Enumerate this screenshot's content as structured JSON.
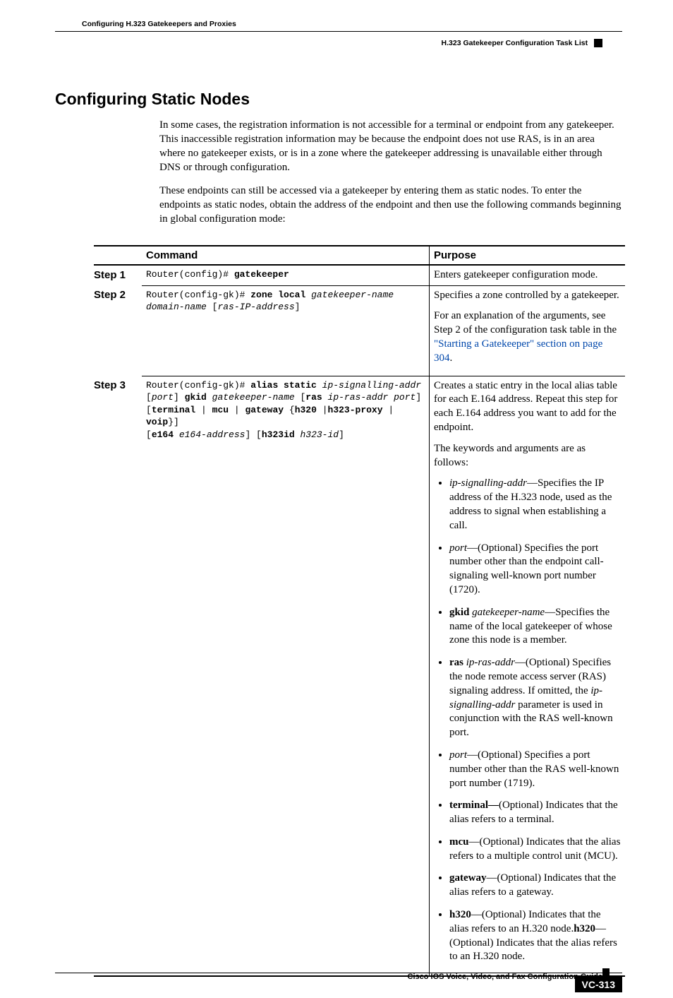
{
  "header": {
    "left": "Configuring H.323 Gatekeepers and Proxies",
    "right": "H.323 Gatekeeper Configuration Task List"
  },
  "section_title": "Configuring Static Nodes",
  "para1": "In some cases, the registration information is not accessible for a terminal or endpoint from any gatekeeper. This inaccessible registration information may be because the endpoint does not use RAS, is in an area where no gatekeeper exists, or is in a zone where the gatekeeper addressing is unavailable either through DNS or through configuration.",
  "para2": "These endpoints can still be accessed via a gatekeeper by entering them as static nodes. To enter the endpoints as static nodes, obtain the address of the endpoint and then use the following commands beginning in global configuration mode:",
  "table": {
    "head_command": "Command",
    "head_purpose": "Purpose",
    "step1_label": "Step 1",
    "step2_label": "Step 2",
    "step3_label": "Step 3",
    "r1": {
      "cmd_prefix": "Router(config)# ",
      "cmd_bold": "gatekeeper",
      "purpose": "Enters gatekeeper configuration mode."
    },
    "r2": {
      "cmd_l1a": "Router(config-gk)# ",
      "cmd_l1b": "zone local ",
      "cmd_l1c": "gatekeeper-name",
      "cmd_l2a": "domain-name ",
      "cmd_l2b": "[",
      "cmd_l2c": "ras-IP-address",
      "cmd_l2d": "]",
      "p1": "Specifies a zone controlled by a gatekeeper.",
      "p2a": "For an explanation of the arguments, see Step 2 of the configuration task table in the ",
      "p2b": "\"Starting a Gatekeeper\" section on page 304",
      "p2c": "."
    },
    "r3": {
      "cmd_l1a": "Router(config-gk)# ",
      "cmd_l1b": "alias static ",
      "cmd_l1c": "ip-signalling-addr",
      "cmd_l2a": "[",
      "cmd_l2b": "port",
      "cmd_l2c": "] ",
      "cmd_l2d": "gkid ",
      "cmd_l2e": "gatekeeper-name ",
      "cmd_l2f": "[",
      "cmd_l2g": "ras ",
      "cmd_l2h": "ip-ras-addr port",
      "cmd_l2i": "]",
      "cmd_l3a": "[",
      "cmd_l3b": "terminal",
      "cmd_l3c": " | ",
      "cmd_l3d": "mcu",
      "cmd_l3e": " | ",
      "cmd_l3f": "gateway ",
      "cmd_l3g": "{",
      "cmd_l3h": "h320 ",
      "cmd_l3i": "|",
      "cmd_l3j": "h323-proxy",
      "cmd_l3k": " | ",
      "cmd_l3l": "voip",
      "cmd_l3m": "}]",
      "cmd_l4a": "[",
      "cmd_l4b": "e164 ",
      "cmd_l4c": "e164-address",
      "cmd_l4d": "] [",
      "cmd_l4e": "h323id ",
      "cmd_l4f": "h323-id",
      "cmd_l4g": "]",
      "p1": "Creates a static entry in the local alias table for each E.164 address. Repeat this step for each E.164 address you want to add for the endpoint.",
      "p2": "The keywords and arguments are as follows:",
      "li1a": "ip-signalling-addr",
      "li1b": "—Specifies the IP address of the H.323 node, used as the address to signal when establishing a call.",
      "li2a": "port",
      "li2b": "—(Optional) Specifies the port number other than the endpoint call-signaling well-known port number (1720).",
      "li3a": "gkid ",
      "li3b": "gatekeeper-name",
      "li3c": "—Specifies the name of the local gatekeeper of whose zone this node is a member.",
      "li4a": "ras ",
      "li4b": "ip-ras-addr",
      "li4c": "—(Optional) Specifies the node remote access server (RAS) signaling address. If omitted, the ",
      "li4d": "ip-signalling-addr",
      "li4e": " parameter is used in conjunction with the RAS well-known port.",
      "li5a": "port",
      "li5b": "—(Optional) Specifies a port number other than the RAS well-known port number (1719).",
      "li6a": "terminal—",
      "li6b": "(Optional) Indicates that the alias refers to a terminal.",
      "li7a": "mcu",
      "li7b": "—(Optional) Indicates that the alias refers to a multiple control unit (MCU).",
      "li8a": "gateway",
      "li8b": "—(Optional) Indicates that the alias refers to a gateway.",
      "li9a": "h320",
      "li9b": "—(Optional) Indicates that the alias refers to an H.320 node.",
      "li9c": "h320",
      "li9d": "—(Optional) Indicates that the alias refers to an H.320 node."
    }
  },
  "footer": {
    "guide": "Cisco IOS Voice, Video, and Fax Configuration Guide",
    "pagenum": "VC-313"
  }
}
